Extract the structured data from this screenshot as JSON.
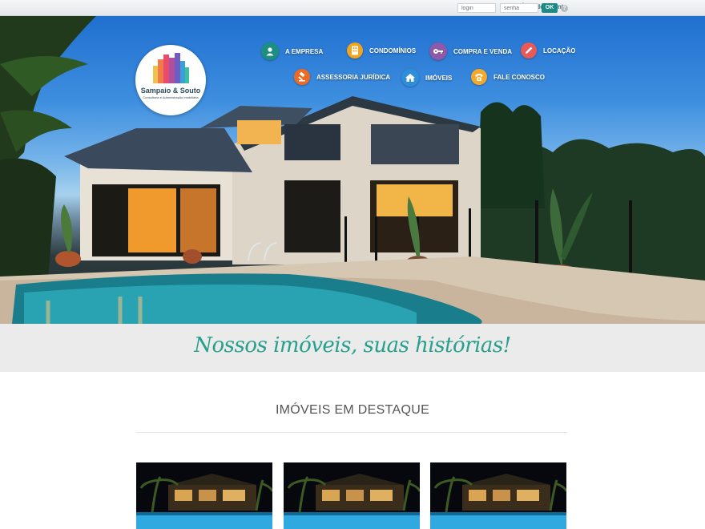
{
  "client_bar": {
    "label": "Área do Cliente",
    "login_placeholder": "login",
    "password_placeholder": "senha",
    "ok_label": "OK",
    "help_label": "?"
  },
  "logo": {
    "name": "Sampaio & Souto",
    "tagline": "Consultoria e Administração Imobiliária"
  },
  "nav": [
    {
      "label": "A EMPRESA",
      "icon": "person-icon",
      "color": "#1d8f82"
    },
    {
      "label": "CONDOMÍNIOS",
      "icon": "building-icon",
      "color": "#f2a41d"
    },
    {
      "label": "COMPRA E VENDA",
      "icon": "key-icon",
      "color": "#8c5aa8"
    },
    {
      "label": "LOCAÇÃO",
      "icon": "pencil-icon",
      "color": "#e85a5a"
    },
    {
      "label": "ASSESSORIA JURÍDICA",
      "icon": "gavel-icon",
      "color": "#ee6a22"
    },
    {
      "label": "IMÓVEIS",
      "icon": "house-icon",
      "color": "#2f8ed8"
    },
    {
      "label": "FALE CONOSCO",
      "icon": "phone-icon",
      "color": "#f4a92a"
    }
  ],
  "slogan": "Nossos imóveis, suas histórias!",
  "featured": {
    "title": "IMÓVEIS EM DESTAQUE",
    "cards": 3
  },
  "colors": {
    "accent": "#26a08c",
    "ok_button": "#1e8a86",
    "band": "#ebebeb"
  }
}
